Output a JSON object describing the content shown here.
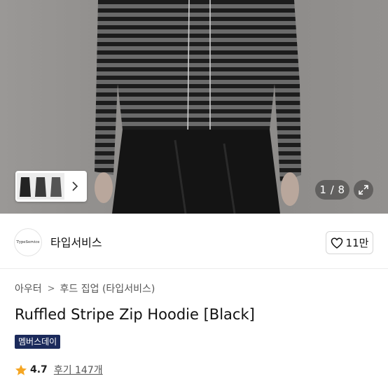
{
  "gallery": {
    "counter": "1 / 8",
    "thumbnail_next_icon": "chevron-right-icon",
    "expand_icon": "expand-diagonal-icon"
  },
  "brand": {
    "logo_text": "TypeService",
    "name": "타입서비스",
    "likes": "11만",
    "like_icon": "heart-outline-icon"
  },
  "breadcrumb": {
    "level1": "아우터",
    "separator": ">",
    "level2": "후드 집업 (타입서비스)"
  },
  "product": {
    "title": "Ruffled Stripe Zip Hoodie [Black]",
    "badge": "멤버스데이"
  },
  "rating": {
    "star_icon": "star-icon",
    "score": "4.7",
    "reviews": "후기 147개"
  },
  "colors": {
    "badge_bg": "#1b2a5b",
    "star": "#f5a623"
  }
}
